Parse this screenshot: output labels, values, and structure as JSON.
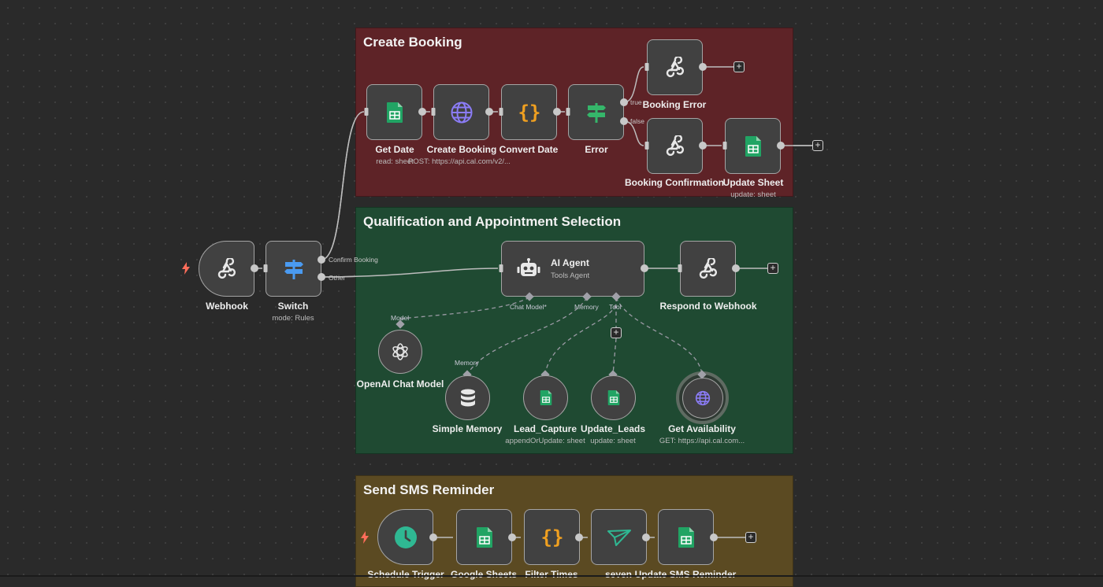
{
  "groups": {
    "create_booking": "Create Booking",
    "qualification": "Qualification and Appointment Selection",
    "sms_reminder": "Send SMS Reminder"
  },
  "nodes": {
    "webhook": {
      "label": "Webhook"
    },
    "switch": {
      "label": "Switch",
      "sub": "mode: Rules"
    },
    "get_date": {
      "label": "Get Date",
      "sub": "read: sheet"
    },
    "create_booking": {
      "label": "Create Booking",
      "sub": "POST: https://api.cal.com/v2/..."
    },
    "convert_date": {
      "label": "Convert Date"
    },
    "error": {
      "label": "Error"
    },
    "booking_error": {
      "label": "Booking Error"
    },
    "booking_confirmation": {
      "label": "Booking Confirmation"
    },
    "update_sheet": {
      "label": "Update Sheet",
      "sub": "update: sheet"
    },
    "ai_agent": {
      "label": "AI Agent",
      "sub": "Tools Agent"
    },
    "respond_to_webhook": {
      "label": "Respond to Webhook"
    },
    "openai_chat_model": {
      "label": "OpenAI Chat Model"
    },
    "simple_memory": {
      "label": "Simple Memory"
    },
    "lead_capture": {
      "label": "Lead_Capture",
      "sub": "appendOrUpdate: sheet"
    },
    "update_leads": {
      "label": "Update_Leads",
      "sub": "update: sheet"
    },
    "get_availability": {
      "label": "Get Availability",
      "sub": "GET: https://api.cal.com..."
    },
    "schedule_trigger": {
      "label": "Schedule Trigger"
    },
    "google_sheets": {
      "label": "Google Sheets"
    },
    "filter_times": {
      "label": "Filter Times"
    },
    "seven": {
      "label": "seven"
    },
    "update_sms_reminder": {
      "label": "Update SMS Reminder"
    }
  },
  "ports": {
    "confirm_booking": "Confirm Booking",
    "other": "Other",
    "true": "true",
    "false": "false",
    "chat_model": "Chat Model*",
    "memory": "Memory",
    "tool": "Tool",
    "model": "Model",
    "memory_in": "Memory"
  },
  "icons": {
    "webhook": "webhook-icon",
    "switch": "signpost-icon",
    "sheets": "google-sheets-icon",
    "http": "globe-icon",
    "code": "braces-icon",
    "if": "signpost-icon",
    "agent": "robot-icon",
    "openai": "openai-icon",
    "memory": "database-icon",
    "schedule": "clock-icon",
    "sms": "send-icon",
    "trigger": "lightning-icon"
  },
  "colors": {
    "canvas": "#2a2a2a",
    "create_booking_group": "#5e2327",
    "qualification_group": "#1f4a32",
    "sms_group": "#5b4a22",
    "sheets_green": "#21a464",
    "http_purple": "#8b7cf6",
    "code_orange": "#f0a020",
    "switch_blue": "#4a9af0",
    "if_green": "#35b66a",
    "schedule_teal": "#2fb893",
    "trigger_red": "#ff6d5a"
  }
}
